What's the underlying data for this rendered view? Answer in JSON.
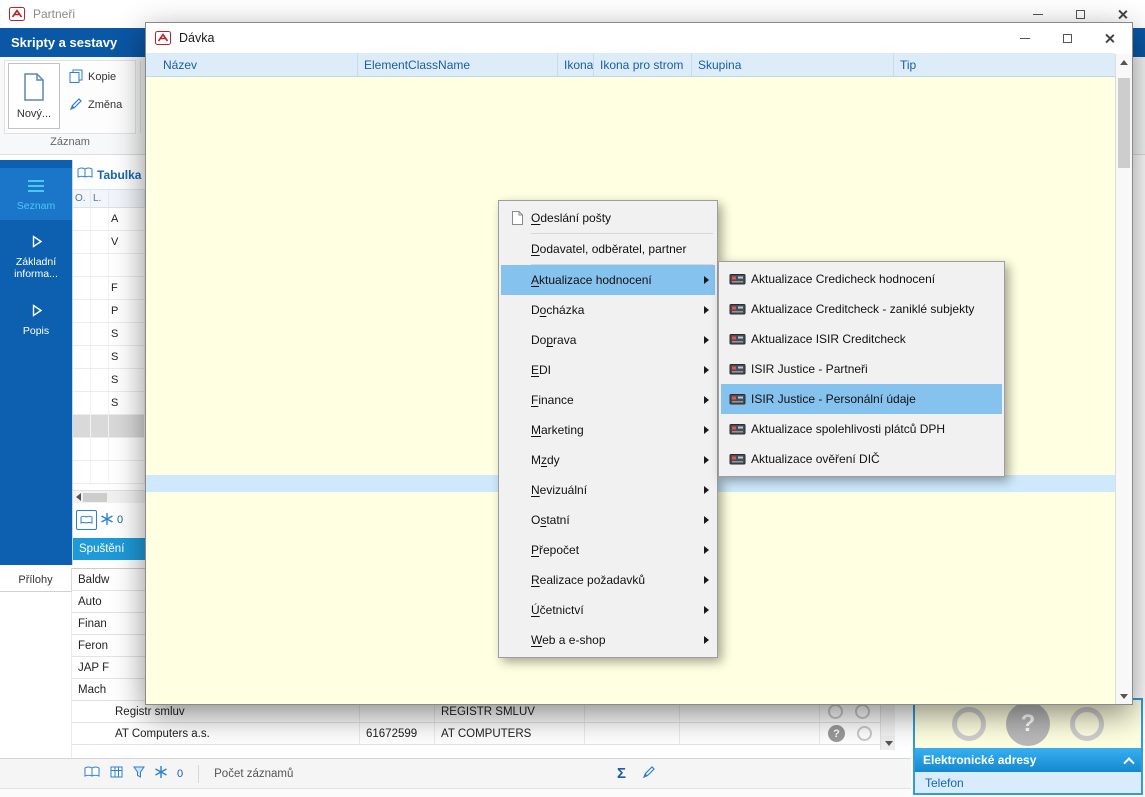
{
  "colors": {
    "ribbon_blue": "#0a57a5",
    "sidebar_blue": "#0d60b0",
    "accent_cyan": "#49c9f5",
    "grid_yellow": "#ffffe1",
    "grid_header_bg": "#ddecf9",
    "grid_header_text": "#1d5da6",
    "menu_highlight": "#86c2ee",
    "selection_stripe": "#cde9fb",
    "run_button_blue": "#1e9ad8",
    "panel_border_blue": "#2f9ce0"
  },
  "glyphs": {
    "sigma": "Σ",
    "question": "?"
  },
  "main_window": {
    "title": "Partneři",
    "ribbon_tab": "Skripty a sestavy",
    "toolbar": {
      "new": "Nový...",
      "copy": "Kopie",
      "change": "Změna",
      "group": "Záznam"
    },
    "sidebar": {
      "items": [
        "Seznam",
        "Základní informa...",
        "Popis"
      ]
    },
    "attachments": "Přílohy",
    "mini_table": {
      "tab": "Tabulka",
      "columns": [
        "O.",
        "L.",
        ""
      ],
      "rows": [
        "A",
        "V",
        "",
        "F",
        "P",
        "S",
        "S",
        "S",
        "S"
      ],
      "count": "0",
      "run_button": "Spuštění"
    },
    "partners_table": {
      "rows": [
        {
          "name": "Baldw",
          "code": "",
          "match": "",
          "indent": 6,
          "icons": []
        },
        {
          "name": "Auto",
          "code": "",
          "match": "",
          "indent": 6,
          "icons": []
        },
        {
          "name": "Finan",
          "code": "",
          "match": "",
          "indent": 6,
          "icons": []
        },
        {
          "name": "Feron",
          "code": "",
          "match": "",
          "indent": 6,
          "icons": []
        },
        {
          "name": "JAP F",
          "code": "",
          "match": "",
          "indent": 6,
          "icons": []
        },
        {
          "name": "Mach",
          "code": "",
          "match": "",
          "indent": 6,
          "icons": []
        },
        {
          "name": "Registr smluv",
          "code": "",
          "match": "REGISTR SMLUV",
          "indent": 43,
          "icons": [
            "ring",
            "ring"
          ]
        },
        {
          "name": "AT Computers a.s.",
          "code": "61672599",
          "match": "AT COMPUTERS",
          "indent": 43,
          "icons": [
            "question",
            "ring"
          ]
        }
      ]
    },
    "status_bar": {
      "count": "0",
      "records_label": "Počet záznamů"
    },
    "right_panel": {
      "header": "Elektronické adresy",
      "sub_item": "Telefon"
    }
  },
  "batch_window": {
    "title": "Dávka",
    "columns": [
      "Název",
      "ElementClassName",
      "Ikona",
      "Ikona pro strom",
      "Skupina",
      "Tip"
    ]
  },
  "context_menu": {
    "items": [
      {
        "label": "Odeslání pošty",
        "mnemonic": "O",
        "icon": "document",
        "submenu": false,
        "separator_after": true
      },
      {
        "label": "Dodavatel, odběratel, partner",
        "mnemonic": "D",
        "submenu": false,
        "separator_after": true
      },
      {
        "label": "Aktualizace hodnocení",
        "mnemonic": "A",
        "submenu": true,
        "selected": true
      },
      {
        "label": "Docházka",
        "mnemonic": "o",
        "submenu": true
      },
      {
        "label": "Doprava",
        "mnemonic": "p",
        "submenu": true
      },
      {
        "label": "EDI",
        "mnemonic": "E",
        "submenu": true
      },
      {
        "label": "Finance",
        "mnemonic": "F",
        "submenu": true
      },
      {
        "label": "Marketing",
        "mnemonic": "M",
        "submenu": true
      },
      {
        "label": "Mzdy",
        "mnemonic": "z",
        "submenu": true
      },
      {
        "label": "Nevizuální",
        "mnemonic": "N",
        "submenu": true
      },
      {
        "label": "Ostatní",
        "mnemonic": "s",
        "submenu": true
      },
      {
        "label": "Přepočet",
        "mnemonic": "P",
        "submenu": true
      },
      {
        "label": "Realizace požadavků",
        "mnemonic": "R",
        "submenu": true
      },
      {
        "label": "Účetnictví",
        "mnemonic": "Ú",
        "submenu": true
      },
      {
        "label": "Web a e-shop",
        "mnemonic": "W",
        "submenu": true
      }
    ]
  },
  "submenu": {
    "items": [
      {
        "label": "Aktualizace Credicheck hodnocení"
      },
      {
        "label": "Aktualizace Creditcheck - zaniklé subjekty"
      },
      {
        "label": "Aktualizace ISIR Creditcheck"
      },
      {
        "label": "ISIR Justice - Partneři"
      },
      {
        "label": "ISIR Justice - Personální údaje",
        "selected": true
      },
      {
        "label": "Aktualizace spolehlivosti plátců DPH"
      },
      {
        "label": "Aktualizace ověření DIČ"
      }
    ]
  }
}
